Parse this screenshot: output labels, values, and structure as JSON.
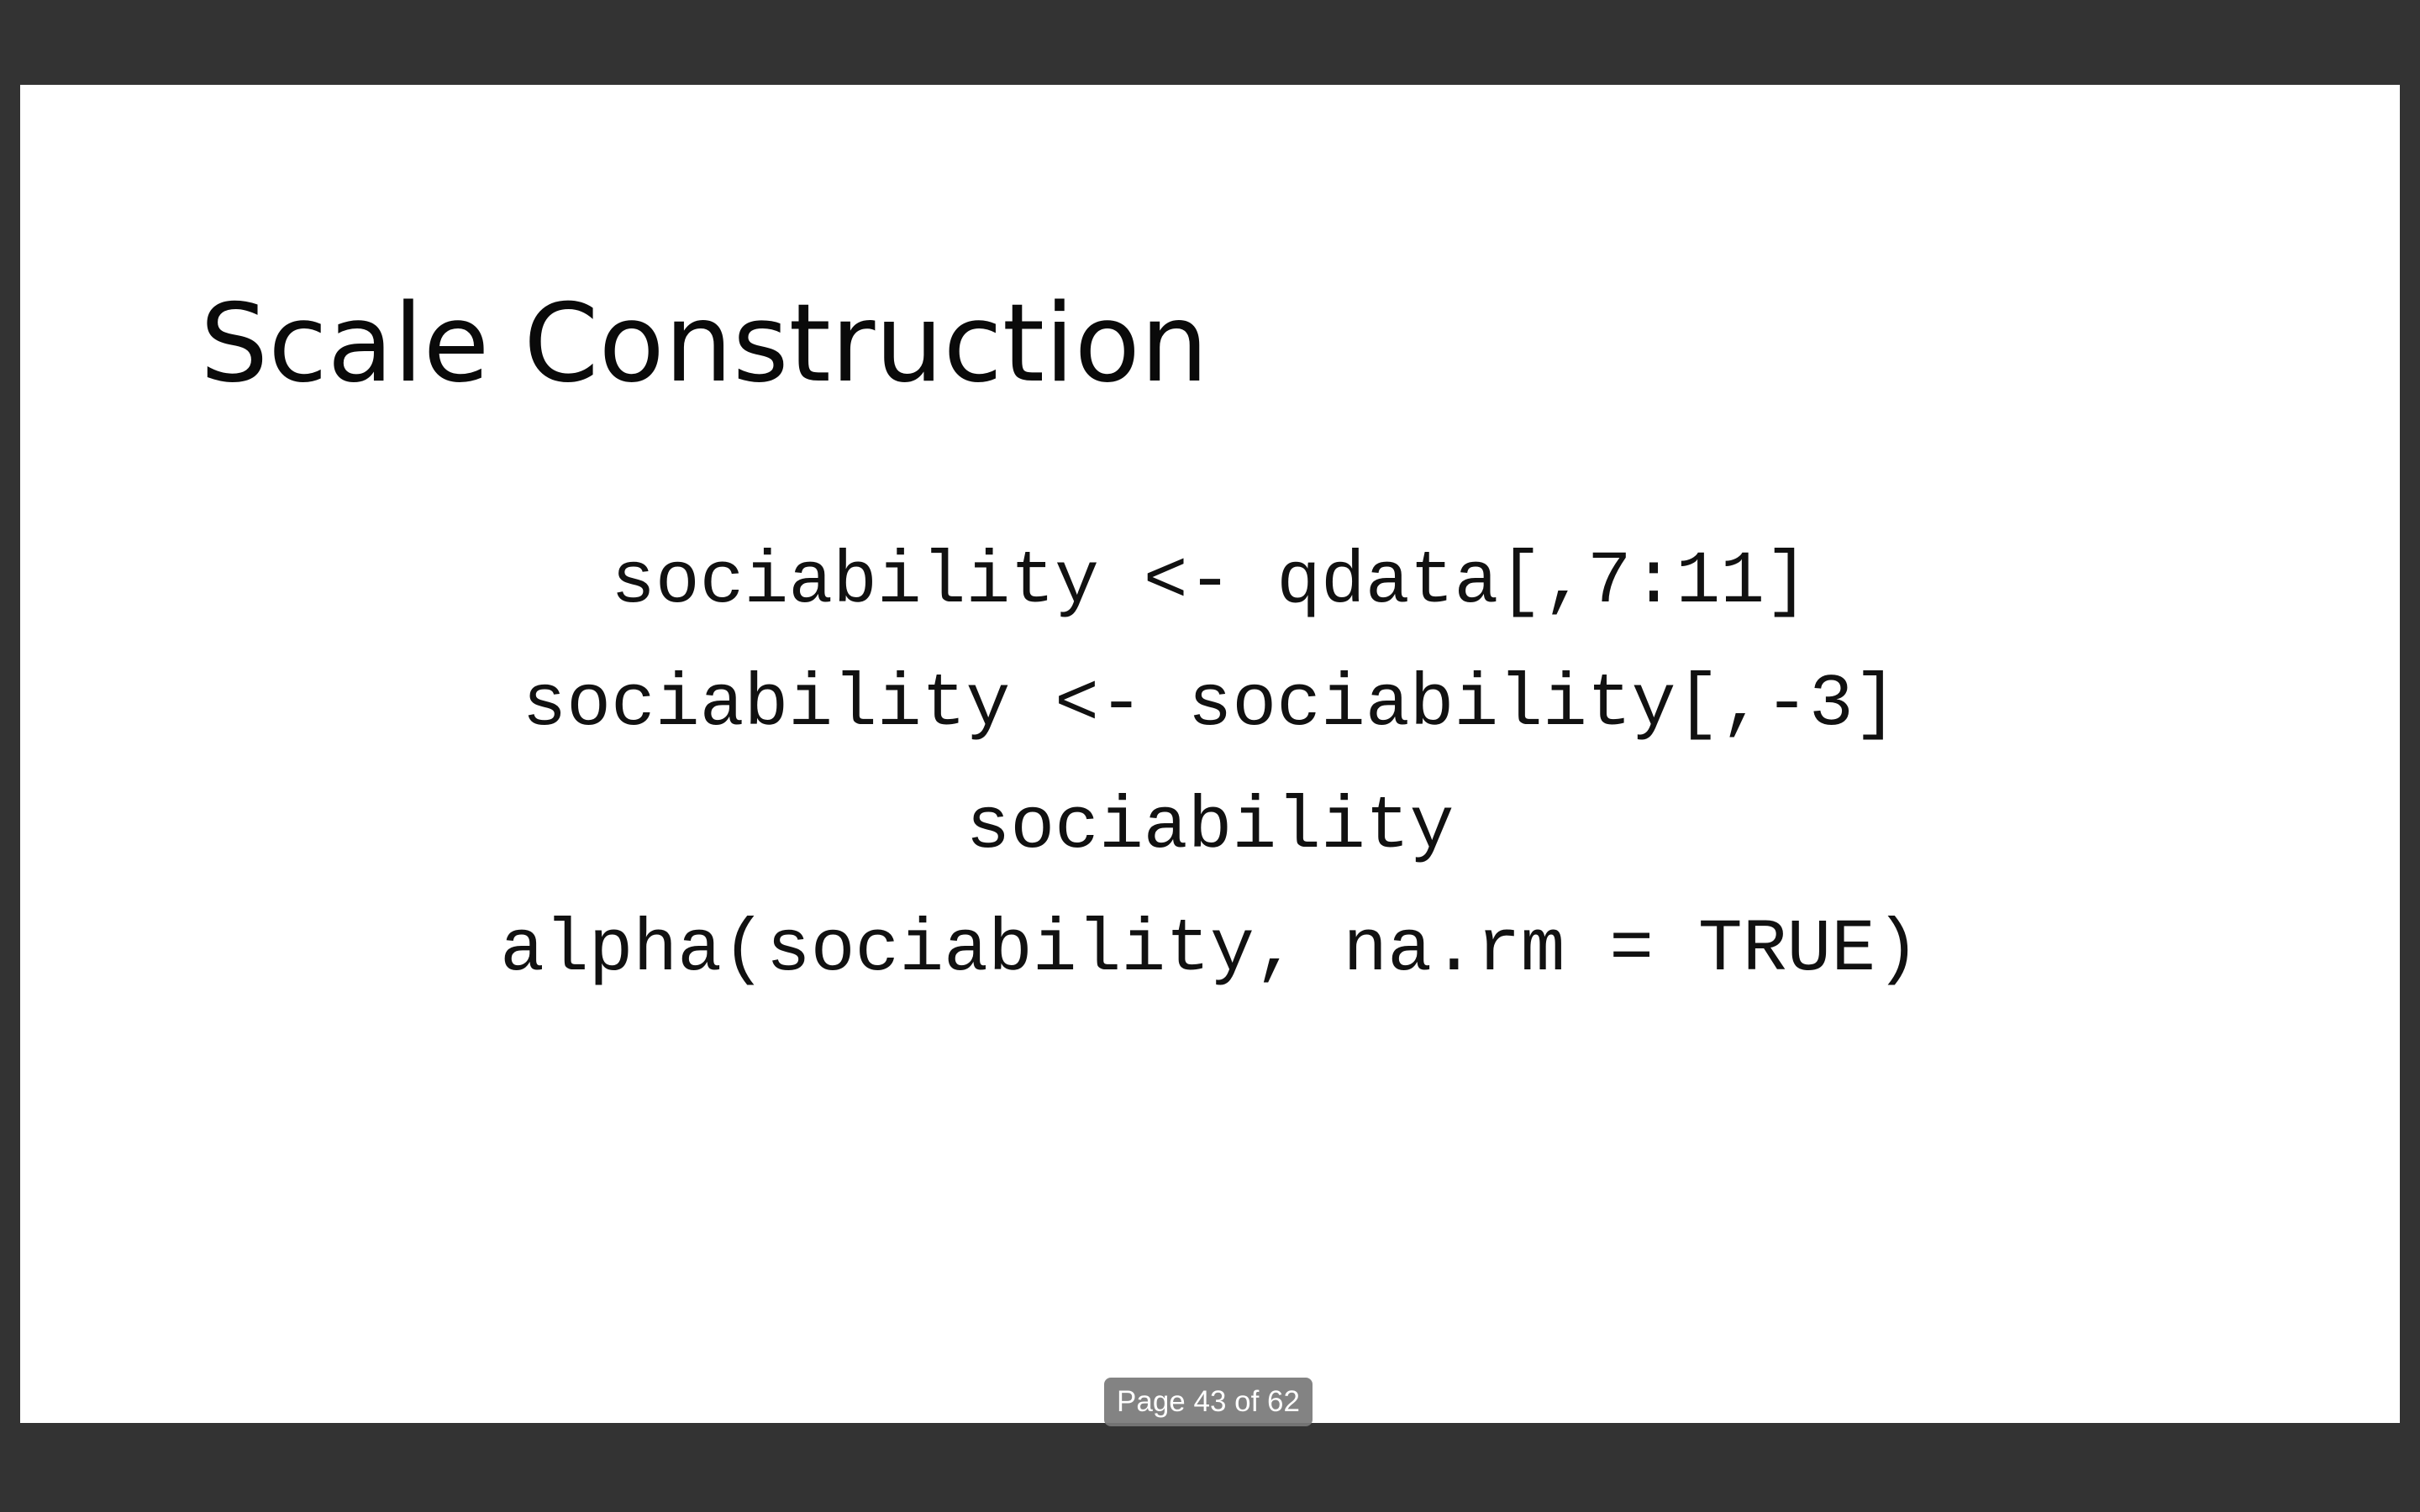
{
  "slide": {
    "title": "Scale Construction",
    "code_lines": [
      "sociability <- qdata[,7:11]",
      "sociability <- sociability[,-3]",
      "sociability",
      "alpha(sociability, na.rm = TRUE)"
    ]
  },
  "page_indicator": {
    "text": "Page 43 of 62",
    "current_page": 43,
    "total_pages": 62
  },
  "colors": {
    "viewer_background": "#333333",
    "slide_background": "#ffffff",
    "text": "#0a0a0a",
    "badge_background": "#787878",
    "badge_text": "#ffffff"
  }
}
